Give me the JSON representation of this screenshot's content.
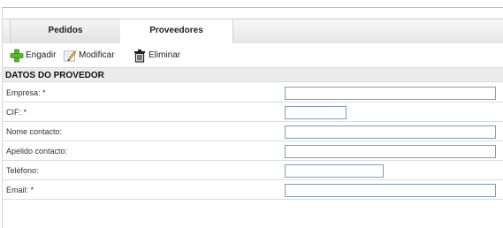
{
  "tabs": [
    {
      "label": "Pedidos",
      "active": false
    },
    {
      "label": "Proveedores",
      "active": true
    }
  ],
  "toolbar": {
    "add_label": "Engadir",
    "add_icon": "green-plus-icon",
    "modify_label": "Modificar",
    "modify_icon": "pencil-paper-icon",
    "delete_label": "Eliminar",
    "delete_icon": "trash-can-icon"
  },
  "section": {
    "title": "DATOS DO PROVEDOR"
  },
  "fields": [
    {
      "label": "Empresa: *",
      "value": ""
    },
    {
      "label": "CIF: *",
      "value": ""
    },
    {
      "label": "Nome contacto:",
      "value": ""
    },
    {
      "label": "Apelido contacto:",
      "value": ""
    },
    {
      "label": "Teléfono:",
      "value": ""
    },
    {
      "label": "Email: *",
      "value": ""
    }
  ],
  "colors": {
    "input_border": "#7f9db9",
    "section_bg": "#ececec",
    "add_icon": "#4caf32"
  }
}
